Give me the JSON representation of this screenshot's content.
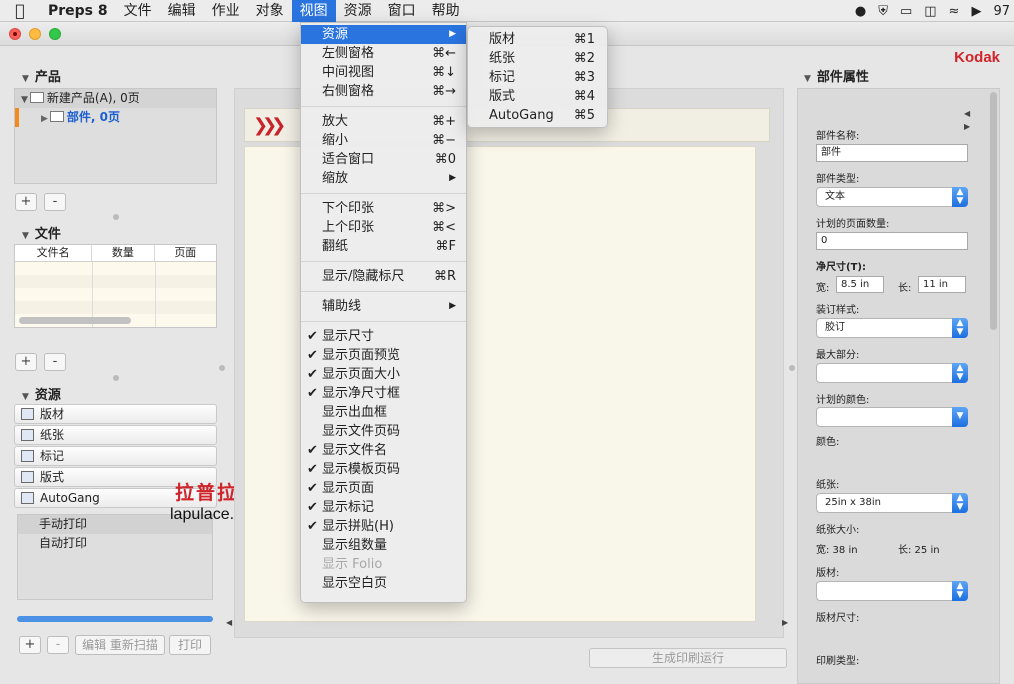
{
  "menubar": {
    "app": "Preps 8",
    "items": [
      "文件",
      "编辑",
      "作业",
      "对象",
      "视图",
      "资源",
      "窗口",
      "帮助"
    ],
    "active_index": 4,
    "right_clip": "97"
  },
  "window": {
    "brand": "Kodak"
  },
  "left": {
    "products_title": "产品",
    "product_root": "新建产品(A), 0页",
    "product_child": "部件, 0页",
    "files_title": "文件",
    "files_columns": [
      "文件名",
      "数量",
      "页面"
    ],
    "resources_title": "资源",
    "resources": [
      {
        "label": "版材",
        "icon": "plate-icon"
      },
      {
        "label": "纸张",
        "icon": "paper-icon"
      },
      {
        "label": "标记",
        "icon": "mark-icon"
      },
      {
        "label": "版式",
        "icon": "layout-icon"
      },
      {
        "label": "AutoGang",
        "icon": "autogang-icon"
      }
    ],
    "print_list": [
      "手动打印",
      "自动打印"
    ],
    "plus": "+",
    "minus": "-",
    "edit": "编辑",
    "rescan": "重新扫描",
    "print": "打印"
  },
  "watermark": {
    "cn": "拉普拉斯",
    "en": "lapulace.com"
  },
  "center": {
    "generate_button": "生成印刷运行"
  },
  "right": {
    "title": "部件属性",
    "part_name_label": "部件名称:",
    "part_name_value": "部件",
    "part_type_label": "部件类型:",
    "part_type_value": "文本",
    "planned_pages_label": "计划的页面数量:",
    "planned_pages_value": "0",
    "trim_label": "净尺寸(T):",
    "width_label": "宽:",
    "width_value": "8.5 in",
    "length_label": "长:",
    "length_value": "11 in",
    "binding_label": "装订样式:",
    "binding_value": "胶订",
    "max_parts_label": "最大部分:",
    "planned_colors_label": "计划的颜色:",
    "color_label": "颜色:",
    "paper_label": "纸张:",
    "paper_value": "25in x 38in",
    "paper_size_label": "纸张大小:",
    "paper_width_text": "宽:  38 in",
    "paper_length_text": "长:  25 in",
    "plate_label": "版材:",
    "plate_size_label": "版材尺寸:",
    "print_type_label": "印刷类型:"
  },
  "view_menu": {
    "items": [
      {
        "label": "资源",
        "shortcut": "▶",
        "highlight": true
      },
      {
        "label": "左侧窗格",
        "shortcut": "⌘←"
      },
      {
        "label": "中间视图",
        "shortcut": "⌘↓"
      },
      {
        "label": "右侧窗格",
        "shortcut": "⌘→"
      },
      {
        "sep": true
      },
      {
        "label": "放大",
        "shortcut": "⌘+"
      },
      {
        "label": "缩小",
        "shortcut": "⌘−"
      },
      {
        "label": "适合窗口",
        "shortcut": "⌘0"
      },
      {
        "label": "缩放",
        "shortcut": "▶"
      },
      {
        "sep": true
      },
      {
        "label": "下个印张",
        "shortcut": "⌘>"
      },
      {
        "label": "上个印张",
        "shortcut": "⌘<"
      },
      {
        "label": "翻纸",
        "shortcut": "⌘F"
      },
      {
        "sep": true
      },
      {
        "label": "显示/隐藏标尺",
        "shortcut": "⌘R"
      },
      {
        "sep": true
      },
      {
        "label": "辅助线",
        "shortcut": "▶"
      },
      {
        "sep": true
      },
      {
        "label": "显示尺寸",
        "checked": true
      },
      {
        "label": "显示页面预览",
        "checked": true
      },
      {
        "label": "显示页面大小",
        "checked": true
      },
      {
        "label": "显示净尺寸框",
        "checked": true
      },
      {
        "label": "显示出血框"
      },
      {
        "label": "显示文件页码"
      },
      {
        "label": "显示文件名",
        "checked": true
      },
      {
        "label": "显示模板页码",
        "checked": true
      },
      {
        "label": "显示页面",
        "checked": true
      },
      {
        "label": "显示标记",
        "checked": true
      },
      {
        "label": "显示拼贴(H)",
        "checked": true
      },
      {
        "label": "显示组数量"
      },
      {
        "label": "显示 Folio",
        "disabled": true
      },
      {
        "label": "显示空白页"
      }
    ]
  },
  "resources_submenu": {
    "items": [
      {
        "label": "版材",
        "shortcut": "⌘1"
      },
      {
        "label": "纸张",
        "shortcut": "⌘2"
      },
      {
        "label": "标记",
        "shortcut": "⌘3"
      },
      {
        "label": "版式",
        "shortcut": "⌘4"
      },
      {
        "label": "AutoGang",
        "shortcut": "⌘5"
      }
    ]
  }
}
